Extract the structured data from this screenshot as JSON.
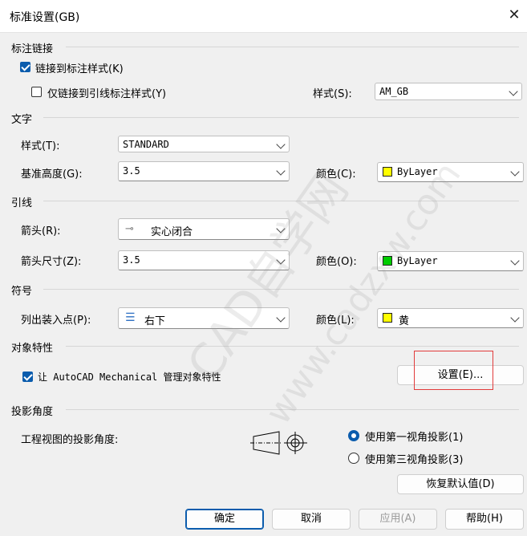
{
  "window": {
    "title": "标准设置(GB)",
    "close_glyph": "✕"
  },
  "dim_link": {
    "section": "标注链接",
    "link_style_label": "链接到标注样式(K)",
    "link_style_checked": true,
    "leader_only_label": "仅链接到引线标注样式(Y)",
    "leader_only_checked": false,
    "style_label": "样式(S):",
    "style_value": "AM_GB"
  },
  "text": {
    "section": "文字",
    "style_label": "样式(T):",
    "style_value": "STANDARD",
    "height_label": "基准高度(G):",
    "height_value": "3.5",
    "color_label": "颜色(C):",
    "color_value": "ByLayer",
    "color_hex": "#ffff00"
  },
  "leader": {
    "section": "引线",
    "arrow_label": "箭头(R):",
    "arrow_glyph": "⊸",
    "arrow_value": "实心闭合",
    "arrow_size_label": "箭头尺寸(Z):",
    "arrow_size_value": "3.5",
    "color_label": "颜色(O):",
    "color_value": "ByLayer",
    "color_hex": "#00cc00"
  },
  "symbol": {
    "section": "符号",
    "insert_label": "列出装入点(P):",
    "insert_glyph": "☰",
    "insert_value": "右下",
    "color_label": "颜色(L):",
    "color_value": "黄",
    "color_hex": "#ffff00"
  },
  "object_props": {
    "section": "对象特性",
    "manage_label": "让 AutoCAD Mechanical 管理对象特性",
    "manage_checked": true,
    "settings_button": "设置(E)..."
  },
  "projection": {
    "section": "投影角度",
    "angle_label": "工程视图的投影角度:",
    "first_angle_label": "使用第一视角投影(1)",
    "first_angle_selected": true,
    "third_angle_label": "使用第三视角投影(3)",
    "third_angle_selected": false,
    "restore_button": "恢复默认值(D)"
  },
  "footer": {
    "ok": "确定",
    "cancel": "取消",
    "apply": "应用(A)",
    "help": "帮助(H)"
  },
  "watermark": {
    "line1": "CAD自学网",
    "line2": "www.cadzxw.com"
  },
  "colors": {
    "accent": "#0b5cad",
    "highlight": "#e23b3b"
  }
}
